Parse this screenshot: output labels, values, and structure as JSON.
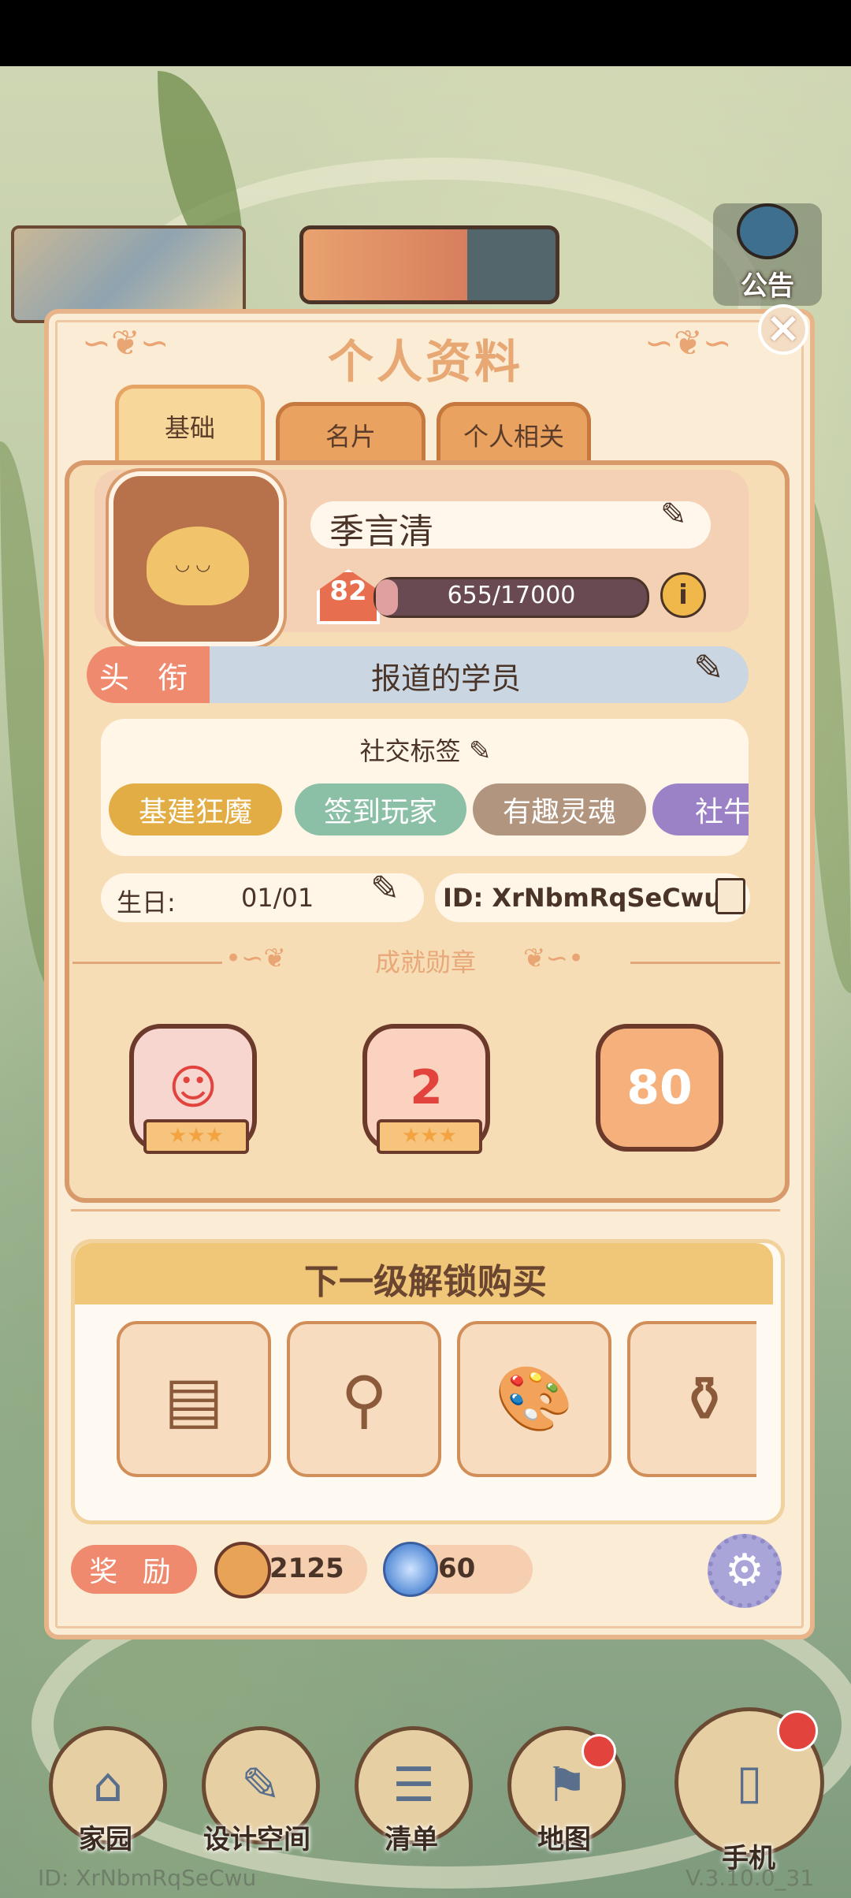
{
  "title": "个人资料",
  "notice_label": "公告",
  "tabs": [
    {
      "label": "基础",
      "active": true
    },
    {
      "label": "名片",
      "active": false
    },
    {
      "label": "个人相关",
      "active": false
    }
  ],
  "profile": {
    "name": "季言清",
    "level": "82",
    "exp": "655/17000",
    "exp_fraction": 0.0385,
    "rank_label": "头 衔",
    "rank_value": "报道的学员"
  },
  "social": {
    "title": "社交标签",
    "tags": [
      {
        "label": "基建狂魔",
        "color": "#e3ad45"
      },
      {
        "label": "签到玩家",
        "color": "#8bc0a6"
      },
      {
        "label": "有趣灵魂",
        "color": "#b1957f"
      },
      {
        "label": "社牛",
        "color": "#9b82c6"
      }
    ]
  },
  "birthday_label": "生日:",
  "birthday_value": "01/01",
  "user_id": "ID: XrNbmRqSeCwu",
  "achievements": {
    "title": "成就勋章",
    "medals": [
      {
        "name": "girl-medal",
        "text": "☺",
        "stars": "★★★",
        "color": "#f8d6d0"
      },
      {
        "name": "number-2-medal",
        "text": "2",
        "stars": "★★★",
        "color": "#fbd2c0"
      },
      {
        "name": "80-medal",
        "text": "80",
        "stars": "",
        "color": "#f6b07b"
      }
    ]
  },
  "purchase": {
    "title": "下一级解锁购买",
    "items": [
      {
        "name": "wood-panel",
        "icon": "▤"
      },
      {
        "name": "easel",
        "icon": "⚲"
      },
      {
        "name": "paint-palette",
        "icon": "🎨"
      },
      {
        "name": "bottle",
        "icon": "⚱"
      }
    ]
  },
  "rewards": {
    "label": "奖 励",
    "coins": "2125",
    "gems": "60"
  },
  "nav": [
    {
      "label": "家园",
      "icon": "⌂"
    },
    {
      "label": "设计空间",
      "icon": "✎"
    },
    {
      "label": "清单",
      "icon": "☰"
    },
    {
      "label": "地图",
      "icon": "⚑"
    },
    {
      "label": "手机",
      "icon": "▯"
    }
  ],
  "footer_id": "ID: XrNbmRqSeCwu",
  "version": "V.3.10.0_31"
}
